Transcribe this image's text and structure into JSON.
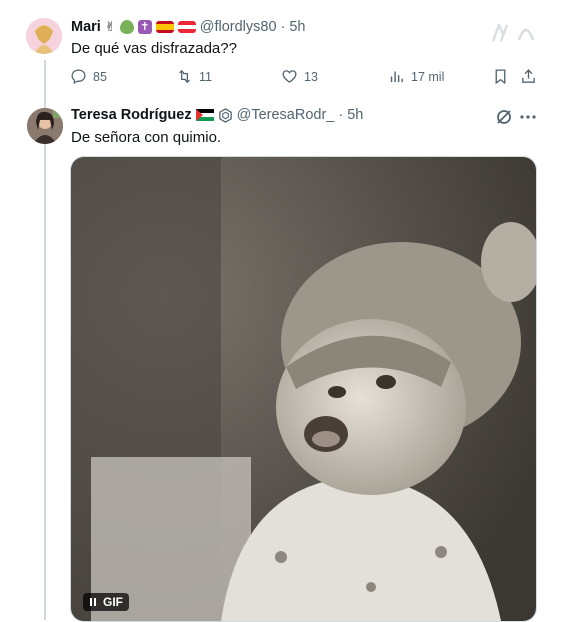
{
  "reply1": {
    "name": "Mari",
    "handle": "@flordlys80",
    "time": "· 5h",
    "text": "De qué vas disfrazada??",
    "stats": {
      "replies": "85",
      "retweets": "11",
      "likes": "13",
      "views": "17 mil"
    }
  },
  "reply2": {
    "name": "Teresa Rodríguez",
    "handle": "@TeresaRodr_",
    "time": "· 5h",
    "text": "De señora con quimio.",
    "gif_label": "GIF"
  },
  "colors": {
    "text": "#0f1419",
    "muted": "#536471",
    "line": "#cfd9de",
    "accent": "#1d9bf0"
  }
}
